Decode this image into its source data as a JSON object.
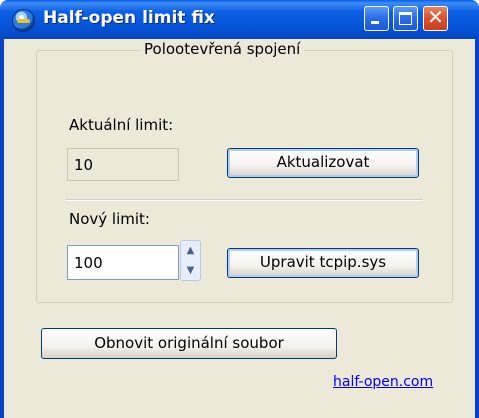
{
  "window": {
    "title": "Half-open limit fix"
  },
  "group": {
    "title": "Polootevřená spojení",
    "current_label": "Aktuální limit:",
    "current_value": "10",
    "refresh_button": "Aktualizovat",
    "new_label": "Nový limit:",
    "new_value": "100",
    "apply_button": "Upravit tcpip.sys"
  },
  "restore_button": "Obnovit originální soubor",
  "link": "half-open.com",
  "icons": {
    "app": "globe-icon",
    "minimize": "minimize-icon",
    "maximize": "maximize-icon",
    "close": "close-icon",
    "spin_up": "chevron-up-icon",
    "spin_down": "chevron-down-icon"
  }
}
